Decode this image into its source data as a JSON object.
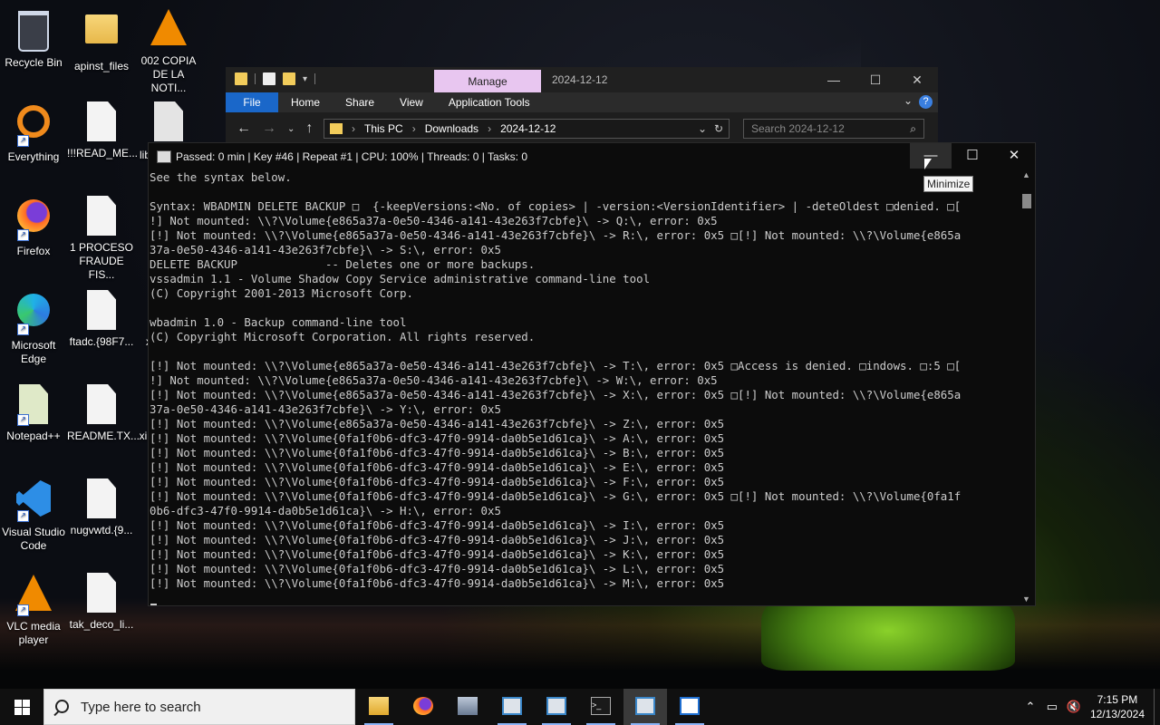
{
  "desktop": {
    "icons": [
      {
        "label": "Recycle Bin",
        "icon": "recycle-bin-icon"
      },
      {
        "label": "apinst_files",
        "icon": "folder-icon"
      },
      {
        "label": "002 COPIA DE LA NOTI...",
        "icon": "vlc-file-icon"
      },
      {
        "label": "Everything",
        "icon": "everything-search-icon"
      },
      {
        "label": "!!!READ_ME...",
        "icon": "document-icon"
      },
      {
        "label": "Firefox",
        "icon": "firefox-icon"
      },
      {
        "label": "1 PROCESO FRAUDE FIS...",
        "icon": "document-icon"
      },
      {
        "label": "Microsoft Edge",
        "icon": "edge-icon"
      },
      {
        "label": "ftadc.{98F7...",
        "icon": "document-icon"
      },
      {
        "label": "Notepad++",
        "icon": "notepad-plus-plus-icon"
      },
      {
        "label": "README.TX...",
        "icon": "document-icon"
      },
      {
        "label": "Visual Studio Code",
        "icon": "vscode-icon"
      },
      {
        "label": "nugvwtd.{9...",
        "icon": "document-icon"
      },
      {
        "label": "VLC media player",
        "icon": "vlc-icon"
      },
      {
        "label": "tak_deco_li...",
        "icon": "document-icon"
      }
    ],
    "partial_labels": [
      "lib",
      "x",
      "xi"
    ]
  },
  "explorer": {
    "manage_tab": "Manage",
    "title": "2024-12-12",
    "ribbon_tabs": [
      "File",
      "Home",
      "Share",
      "View",
      "Application Tools"
    ],
    "breadcrumb": [
      "This PC",
      "Downloads",
      "2024-12-12"
    ],
    "search_placeholder": "Search 2024-12-12",
    "controls": {
      "minimize": "—",
      "maximize": "☐",
      "close": "✕"
    }
  },
  "console": {
    "title": "Passed: 0 min | Key #46 | Repeat #1 | CPU: 100% | Threads: 0 | Tasks: 0",
    "tooltip": "Minimize",
    "controls": {
      "minimize": "—",
      "maximize": "☐",
      "close": "✕"
    },
    "lines": [
      "See the syntax below.",
      "",
      "Syntax: WBADMIN DELETE BACKUP □  {-keepVersions:<No. of copies> | -version:<VersionIdentifier> | -deteOldest □denied. □[",
      "!] Not mounted: \\\\?\\Volume{e865a37a-0e50-4346-a141-43e263f7cbfe}\\ -> Q:\\, error: 0x5",
      "[!] Not mounted: \\\\?\\Volume{e865a37a-0e50-4346-a141-43e263f7cbfe}\\ -> R:\\, error: 0x5 □[!] Not mounted: \\\\?\\Volume{e865a",
      "37a-0e50-4346-a141-43e263f7cbfe}\\ -> S:\\, error: 0x5",
      "DELETE BACKUP             -- Deletes one or more backups.",
      "vssadmin 1.1 - Volume Shadow Copy Service administrative command-line tool",
      "(C) Copyright 2001-2013 Microsoft Corp.",
      "",
      "wbadmin 1.0 - Backup command-line tool",
      "(C) Copyright Microsoft Corporation. All rights reserved.",
      "",
      "[!] Not mounted: \\\\?\\Volume{e865a37a-0e50-4346-a141-43e263f7cbfe}\\ -> T:\\, error: 0x5 □Access is denied. □indows. □:5 □[",
      "!] Not mounted: \\\\?\\Volume{e865a37a-0e50-4346-a141-43e263f7cbfe}\\ -> W:\\, error: 0x5",
      "[!] Not mounted: \\\\?\\Volume{e865a37a-0e50-4346-a141-43e263f7cbfe}\\ -> X:\\, error: 0x5 □[!] Not mounted: \\\\?\\Volume{e865a",
      "37a-0e50-4346-a141-43e263f7cbfe}\\ -> Y:\\, error: 0x5",
      "[!] Not mounted: \\\\?\\Volume{e865a37a-0e50-4346-a141-43e263f7cbfe}\\ -> Z:\\, error: 0x5",
      "[!] Not mounted: \\\\?\\Volume{0fa1f0b6-dfc3-47f0-9914-da0b5e1d61ca}\\ -> A:\\, error: 0x5",
      "[!] Not mounted: \\\\?\\Volume{0fa1f0b6-dfc3-47f0-9914-da0b5e1d61ca}\\ -> B:\\, error: 0x5",
      "[!] Not mounted: \\\\?\\Volume{0fa1f0b6-dfc3-47f0-9914-da0b5e1d61ca}\\ -> E:\\, error: 0x5",
      "[!] Not mounted: \\\\?\\Volume{0fa1f0b6-dfc3-47f0-9914-da0b5e1d61ca}\\ -> F:\\, error: 0x5",
      "[!] Not mounted: \\\\?\\Volume{0fa1f0b6-dfc3-47f0-9914-da0b5e1d61ca}\\ -> G:\\, error: 0x5 □[!] Not mounted: \\\\?\\Volume{0fa1f",
      "0b6-dfc3-47f0-9914-da0b5e1d61ca}\\ -> H:\\, error: 0x5",
      "[!] Not mounted: \\\\?\\Volume{0fa1f0b6-dfc3-47f0-9914-da0b5e1d61ca}\\ -> I:\\, error: 0x5",
      "[!] Not mounted: \\\\?\\Volume{0fa1f0b6-dfc3-47f0-9914-da0b5e1d61ca}\\ -> J:\\, error: 0x5",
      "[!] Not mounted: \\\\?\\Volume{0fa1f0b6-dfc3-47f0-9914-da0b5e1d61ca}\\ -> K:\\, error: 0x5",
      "[!] Not mounted: \\\\?\\Volume{0fa1f0b6-dfc3-47f0-9914-da0b5e1d61ca}\\ -> L:\\, error: 0x5",
      "[!] Not mounted: \\\\?\\Volume{0fa1f0b6-dfc3-47f0-9914-da0b5e1d61ca}\\ -> M:\\, error: 0x5"
    ]
  },
  "taskbar": {
    "search_placeholder": "Type here to search",
    "apps": [
      "file-explorer-icon",
      "firefox-icon",
      "network-app-icon",
      "console-window-icon",
      "console-window-icon",
      "terminal-icon",
      "console-window-icon",
      "blue-app-icon"
    ],
    "time": "7:15 PM",
    "date": "12/13/2024"
  }
}
